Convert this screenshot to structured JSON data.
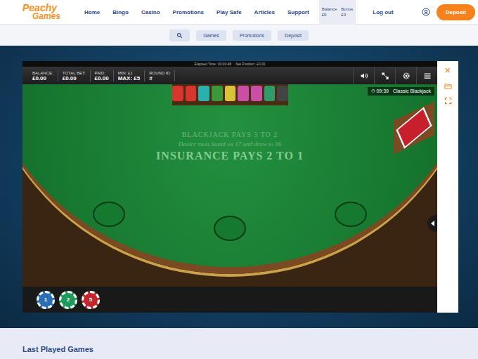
{
  "logo": {
    "line1": "Peachy",
    "line2": "Games"
  },
  "nav": [
    {
      "label": "Home"
    },
    {
      "label": "Bingo"
    },
    {
      "label": "Casino"
    },
    {
      "label": "Promotions"
    },
    {
      "label": "Play Safe"
    },
    {
      "label": "Articles"
    },
    {
      "label": "Support"
    }
  ],
  "wallet": [
    {
      "label": "Balance",
      "value": "£0"
    },
    {
      "label": "Bonus",
      "value": "£0"
    }
  ],
  "logout": "Log out",
  "deposit_button": "Deposit",
  "subnav": [
    {
      "label": "Games"
    },
    {
      "label": "Promotions"
    },
    {
      "label": "Deposit"
    }
  ],
  "game": {
    "status": [
      "Elapsed Time: 00:00:48",
      "Net Position: £0.00"
    ],
    "stats": [
      {
        "label": "BALANCE:",
        "value": "£0.00"
      },
      {
        "label": "TOTAL BET:",
        "value": "£0.00"
      },
      {
        "label": "PAID:",
        "value": "£0.00"
      },
      {
        "label": "MIN: £1",
        "value": "MAX: £5"
      },
      {
        "label": "ROUND ID",
        "value": "#"
      }
    ],
    "timer": "⏱ 09:39",
    "title": "Classic Blackjack",
    "table_lines": [
      "BLACKJACK PAYS 3 TO 2",
      "Dealer must Stand on 17 and draw to 16",
      "INSURANCE PAYS 2 TO 1"
    ],
    "chips": [
      {
        "value": "1",
        "color": "#2a6fb5"
      },
      {
        "value": "2",
        "color": "#1f9a5a"
      },
      {
        "value": "5",
        "color": "#c0262c"
      }
    ],
    "close": "×"
  },
  "section_heading": "Last Played Games"
}
